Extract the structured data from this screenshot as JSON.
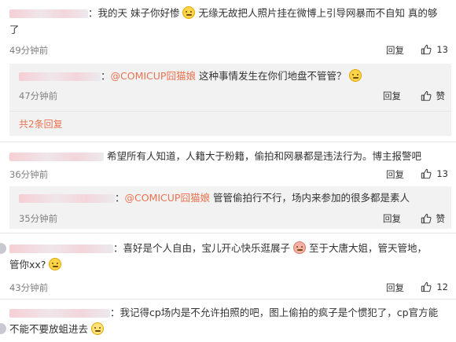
{
  "comments": [
    {
      "text_a": "：我的天 妹子你好惨",
      "text_b": "无缘无故把人照片挂在微博上引导网暴而不自知 真的够",
      "text_c": "了",
      "time": "49分钟前",
      "reply_label": "回复",
      "like_count": "13",
      "replies": [
        {
          "mention": "@COMICUP囧猫娘",
          "text": "这种事情发生在你们地盘不管管？",
          "time": "47分钟前",
          "reply_label": "回复",
          "like_label": "赞"
        }
      ],
      "more_replies": "共2条回复"
    },
    {
      "text": "希望所有人知道，人籍大于粉籍，偷拍和网暴都是违法行为。博主报警吧",
      "time": "36分钟前",
      "reply_label": "回复",
      "like_count": "13",
      "replies": [
        {
          "mention": "@COMICUP囧猫娘",
          "text": "管管偷拍行不行，场内来参加的很多都是素人",
          "time": "35分钟前",
          "reply_label": "回复",
          "like_label": "赞"
        }
      ]
    },
    {
      "text_a": "：喜好是个人自由，宝儿开心快乐逛展子",
      "text_b": "至于大唐大姐，管天管地，",
      "text_c": "管你xx?",
      "time": "43分钟前",
      "reply_label": "回复",
      "like_count": "12"
    },
    {
      "text_a": "：我记得cp场内是不允许拍照的吧，图上偷拍的疯子是个惯犯了，cp官方能",
      "text_b": "不能不要放蛆进去"
    }
  ],
  "icons": {
    "thumb": "thumbs-up-icon",
    "emoji_sad": "sad-face-emoji",
    "emoji_confused": "confused-face-emoji",
    "emoji_girl": "girl-face-emoji",
    "emoji_sweat": "sweat-face-emoji"
  },
  "colors": {
    "link": "#eb7350",
    "meta": "#808080",
    "reply_bg": "#f2f2f2"
  }
}
